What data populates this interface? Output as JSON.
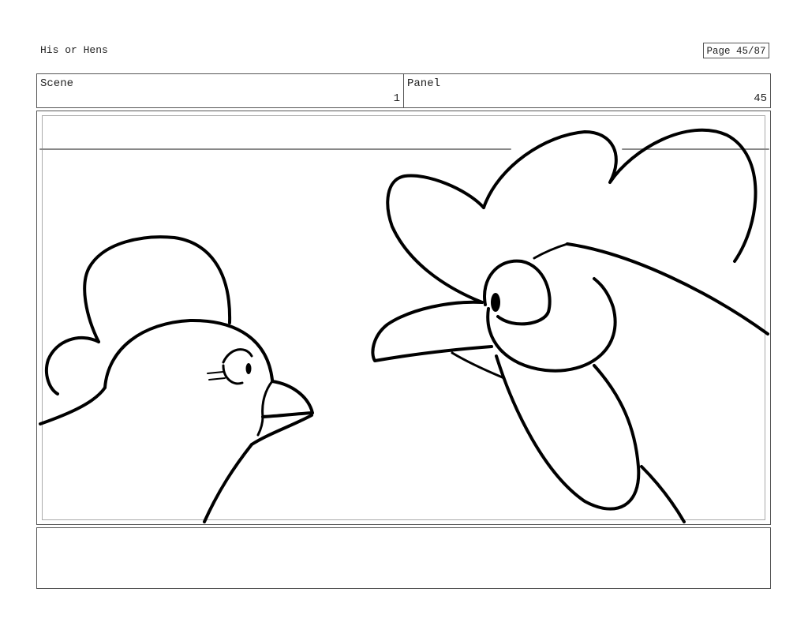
{
  "header": {
    "title": "His or Hens",
    "page_label": "Page 45/87"
  },
  "info": {
    "scene_label": "Scene",
    "scene_value": "1",
    "panel_label": "Panel",
    "panel_value": "45"
  },
  "notes": {
    "text": ""
  }
}
